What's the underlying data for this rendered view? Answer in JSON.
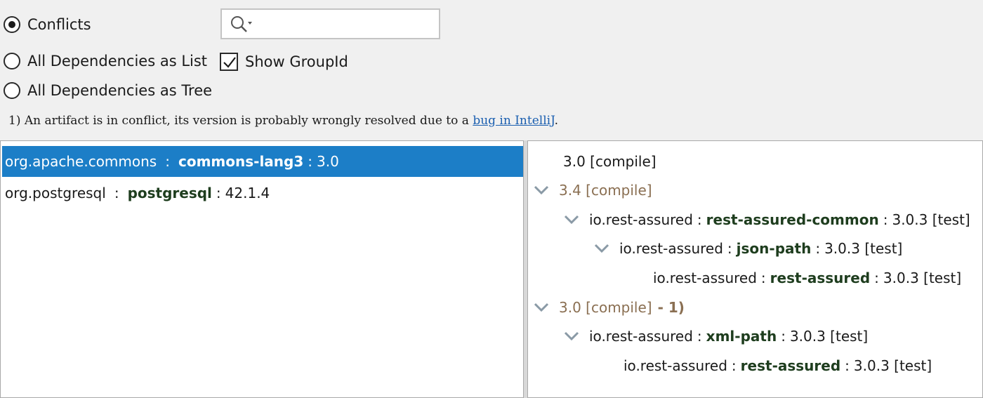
{
  "modes": {
    "conflicts": {
      "label": "Conflicts",
      "selected": true
    },
    "all_list": {
      "label": "All Dependencies as List",
      "selected": false
    },
    "all_tree": {
      "label": "All Dependencies as Tree",
      "selected": false
    }
  },
  "search": {
    "value": "",
    "placeholder": ""
  },
  "show_groupid": {
    "label": "Show GroupId",
    "checked": true
  },
  "note": {
    "text": "1) An artifact is in conflict, its version is probably wrongly resolved due to a ",
    "link_text": "bug in IntelliJ",
    "end": "."
  },
  "conflict_list": [
    {
      "group": "org.apache.commons",
      "artifact": "commons-lang3",
      "version": "3.0",
      "selected": true
    },
    {
      "group": "org.postgresql",
      "artifact": "postgresql",
      "version": "42.1.4",
      "selected": false
    }
  ],
  "tree": {
    "row0": {
      "text": "3.0 [compile]"
    },
    "row1": {
      "text": "3.4 [compile]"
    },
    "row2": {
      "group": "io.rest-assured",
      "artifact": "rest-assured-common",
      "version": "3.0.3 [test]"
    },
    "row3": {
      "group": "io.rest-assured",
      "artifact": "json-path",
      "version": "3.0.3 [test]"
    },
    "row4": {
      "group": "io.rest-assured",
      "artifact": "rest-assured",
      "version": "3.0.3 [test]"
    },
    "row5": {
      "text": "3.0 [compile]",
      "suffix": "- 1)"
    },
    "row6": {
      "group": "io.rest-assured",
      "artifact": "xml-path",
      "version": "3.0.3 [test]"
    },
    "row7": {
      "group": "io.rest-assured",
      "artifact": "rest-assured",
      "version": "3.0.3 [test]"
    }
  },
  "colors": {
    "selection": "#1c7ec7",
    "artifact": "#1e3d1e",
    "muted_version": "#8a6f52",
    "link": "#1b5fb0"
  }
}
